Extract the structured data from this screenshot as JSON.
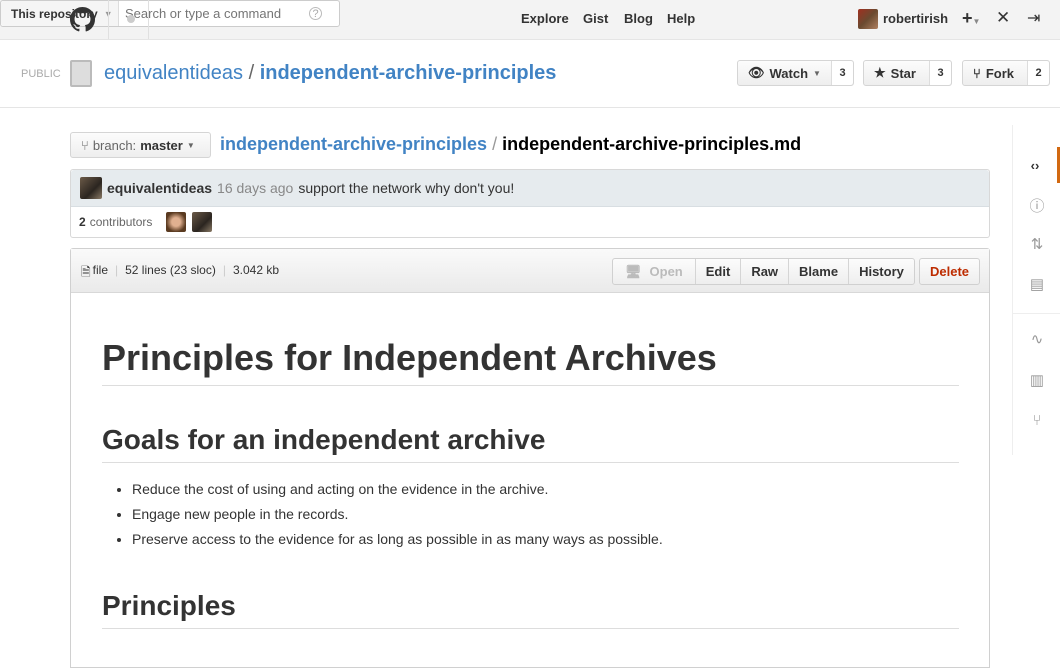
{
  "header": {
    "scope": "This repository",
    "search_placeholder": "Search or type a command",
    "nav": [
      "Explore",
      "Gist",
      "Blog",
      "Help"
    ],
    "username": "robertirish"
  },
  "repo": {
    "visibility": "PUBLIC",
    "owner": "equivalentideas",
    "name": "independent-archive-principles",
    "watch_label": "Watch",
    "watch_count": "3",
    "star_label": "Star",
    "star_count": "3",
    "fork_label": "Fork",
    "fork_count": "2"
  },
  "file": {
    "branch_prefix": "branch:",
    "branch": "master",
    "repo_link": "independent-archive-principles",
    "separator": "/",
    "filename": "independent-archive-principles.md"
  },
  "commit": {
    "author": "equivalentideas",
    "time": "16 days ago",
    "message": "support the network why don't you!",
    "contributors_count": "2",
    "contributors_label": "contributors"
  },
  "file_meta": {
    "type": "file",
    "lines": "52 lines (23 sloc)",
    "size": "3.042 kb",
    "actions": [
      "Open",
      "Edit",
      "Raw",
      "Blame",
      "History"
    ],
    "delete": "Delete"
  },
  "content": {
    "h1": "Principles for Independent Archives",
    "h2a": "Goals for an independent archive",
    "items": [
      "Reduce the cost of using and acting on the evidence in the archive.",
      "Engage new people in the records.",
      "Preserve access to the evidence for as long as possible in as many ways as possible."
    ],
    "h2b": "Principles"
  },
  "colors": {
    "link": "#4183c4",
    "delete": "#bd2c00",
    "active_tab": "#d26911"
  }
}
